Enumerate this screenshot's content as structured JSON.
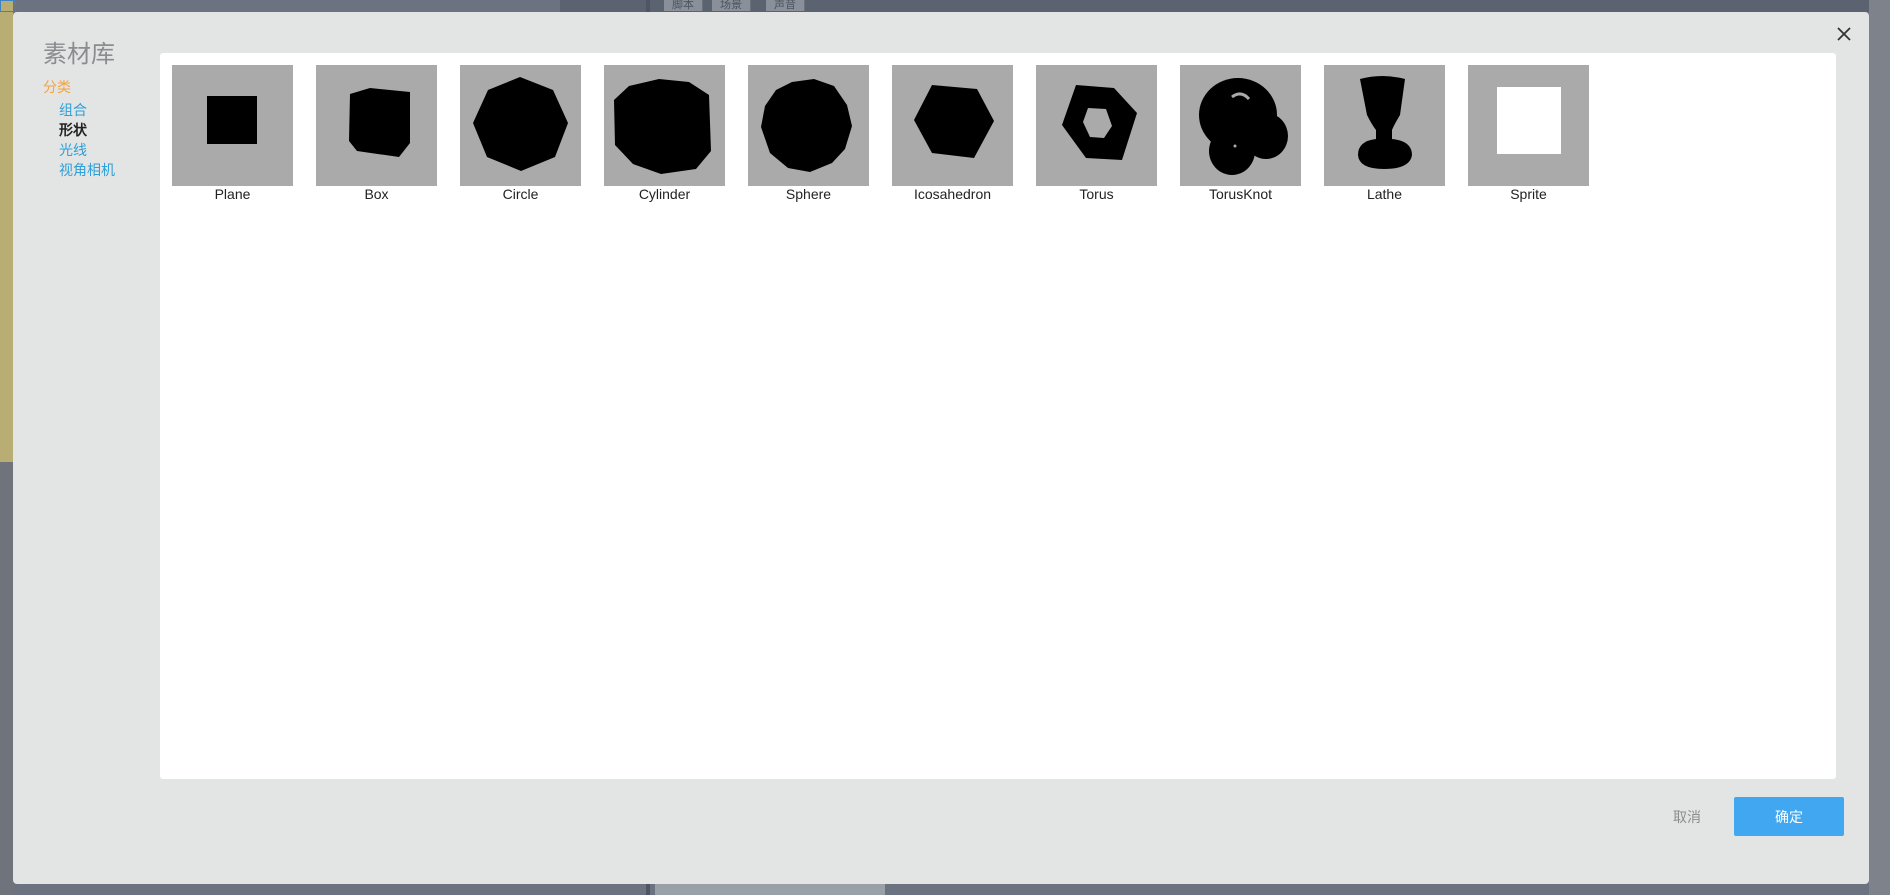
{
  "dialog": {
    "title": "素材库",
    "close_icon": "close-icon"
  },
  "sidebar": {
    "header": "分类",
    "items": [
      {
        "label": "组合",
        "active": false
      },
      {
        "label": "形状",
        "active": true
      },
      {
        "label": "光线",
        "active": false
      },
      {
        "label": "视角相机",
        "active": false
      }
    ]
  },
  "assets": [
    {
      "name": "Plane",
      "icon": "plane-shape-icon"
    },
    {
      "name": "Box",
      "icon": "box-shape-icon"
    },
    {
      "name": "Circle",
      "icon": "circle-shape-icon"
    },
    {
      "name": "Cylinder",
      "icon": "cylinder-shape-icon"
    },
    {
      "name": "Sphere",
      "icon": "sphere-shape-icon"
    },
    {
      "name": "Icosahedron",
      "icon": "icosahedron-shape-icon"
    },
    {
      "name": "Torus",
      "icon": "torus-shape-icon"
    },
    {
      "name": "TorusKnot",
      "icon": "torusknot-shape-icon"
    },
    {
      "name": "Lathe",
      "icon": "lathe-shape-icon"
    },
    {
      "name": "Sprite",
      "icon": "sprite-shape-icon"
    }
  ],
  "footer": {
    "cancel_label": "取消",
    "ok_label": "确定"
  },
  "colors": {
    "accent": "#41a7f0",
    "category_header": "#f4a340",
    "category_link": "#2d9fd9",
    "thumb_bg": "#aaaaaa"
  },
  "background": {
    "tabs": [
      "脚本",
      "场景",
      "声音"
    ]
  }
}
